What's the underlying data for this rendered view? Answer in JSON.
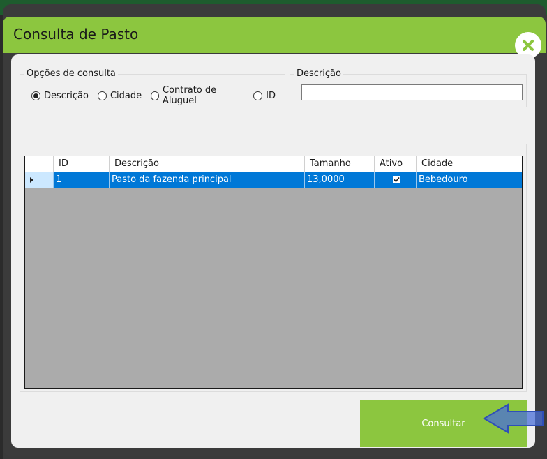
{
  "window": {
    "title": "Consulta de Pasto"
  },
  "options_group": {
    "legend": "Opções de consulta",
    "radios": [
      {
        "label": "Descrição",
        "selected": true
      },
      {
        "label": "Cidade",
        "selected": false
      },
      {
        "label": "Contrato de Aluguel",
        "selected": false
      },
      {
        "label": "ID",
        "selected": false
      }
    ]
  },
  "description_group": {
    "legend": "Descrição",
    "value": ""
  },
  "grid": {
    "columns": [
      "ID",
      "Descrição",
      "Tamanho",
      "Ativo",
      "Cidade"
    ],
    "rows": [
      {
        "id": "1",
        "descricao": "Pasto da fazenda principal",
        "tamanho": "13,0000",
        "ativo": true,
        "cidade": "Bebedouro"
      }
    ]
  },
  "actions": {
    "consultar_label": "Consultar"
  },
  "colors": {
    "accent_green": "#8cc63f",
    "selection_blue": "#0078d7",
    "annotation_arrow": "#4a6fd8"
  }
}
